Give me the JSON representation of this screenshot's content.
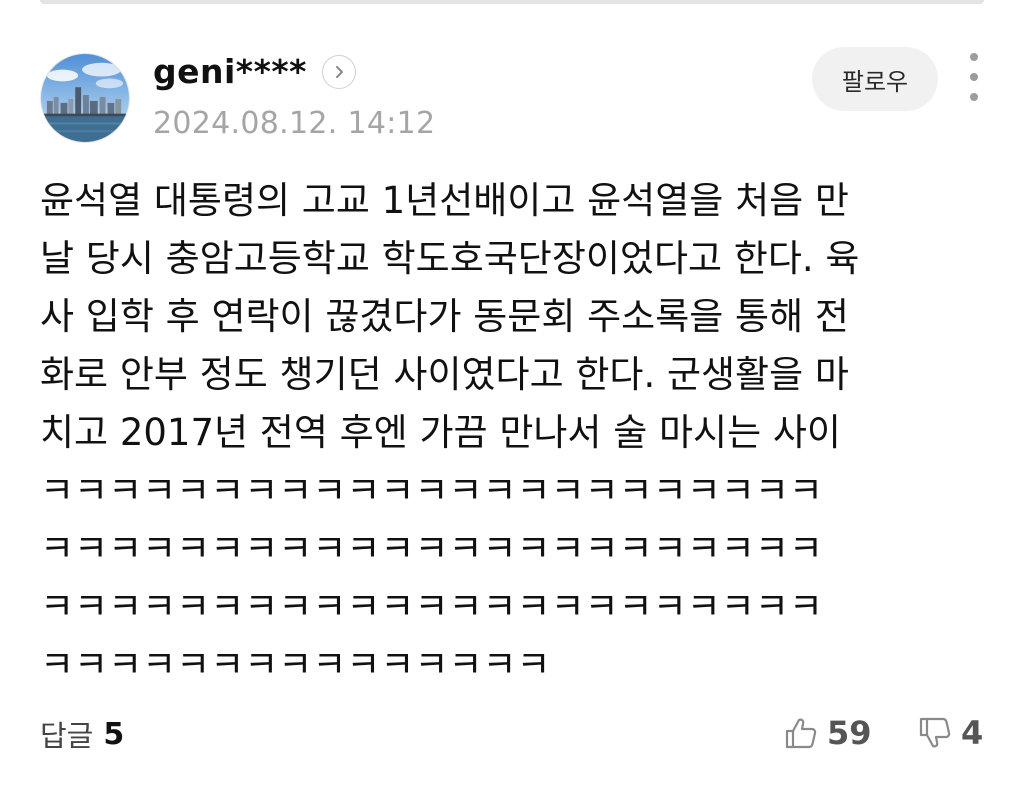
{
  "comment": {
    "author": "geni****",
    "timestamp": "2024.08.12. 14:12",
    "follow_label": "팔로우",
    "body_lines": [
      "윤석열 대통령의 고교 1년선배이고 윤석열을 처음 만",
      "날 당시 충암고등학교 학도호국단장이었다고 한다. 육",
      "사 입학 후 연락이 끊겼다가 동문회 주소록을 통해 전",
      "화로 안부 정도 챙기던 사이였다고 한다. 군생활을 마",
      "치고 2017년 전역 후엔 가끔 만나서 술 마시는 사이",
      "ㅋㅋㅋㅋㅋㅋㅋㅋㅋㅋㅋㅋㅋㅋㅋㅋㅋㅋㅋㅋㅋㅋㅋ",
      "ㅋㅋㅋㅋㅋㅋㅋㅋㅋㅋㅋㅋㅋㅋㅋㅋㅋㅋㅋㅋㅋㅋㅋ",
      "ㅋㅋㅋㅋㅋㅋㅋㅋㅋㅋㅋㅋㅋㅋㅋㅋㅋㅋㅋㅋㅋㅋㅋ",
      "ㅋㅋㅋㅋㅋㅋㅋㅋㅋㅋㅋㅋㅋㅋㅋ"
    ],
    "replies_label": "답글",
    "replies_count": "5",
    "like_count": "59",
    "dislike_count": "4"
  },
  "icons": {
    "avatar": "city-skyline-avatar",
    "profile_link": "chevron-right-icon",
    "more": "vertical-dots-icon",
    "like": "thumbs-up-icon",
    "dislike": "thumbs-down-icon"
  },
  "colors": {
    "text_primary": "#111111",
    "text_secondary": "#a5a5a5",
    "button_bg": "#f1f1f1",
    "icon_gray": "#9c9c9c"
  }
}
